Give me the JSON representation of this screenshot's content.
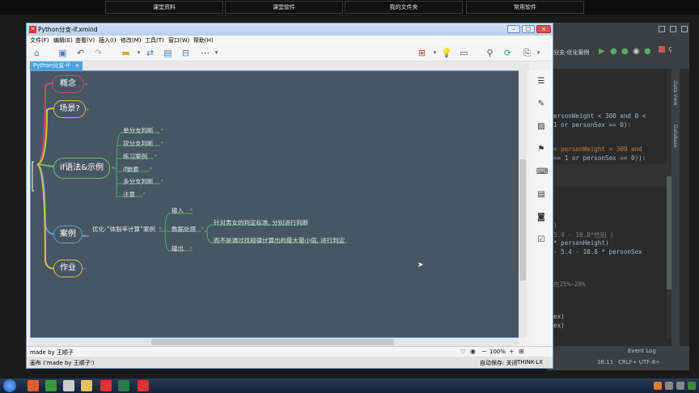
{
  "top_tabs": [
    "课堂资料",
    "课堂软件",
    "我的文件夹",
    "常用软件"
  ],
  "window": {
    "title": "Python分支-if.xmind",
    "menu": [
      "文件(F)",
      "编辑(E)",
      "查看(V)",
      "插入(I)",
      "修改(M)",
      "工具(T)",
      "窗口(W)",
      "帮助(H)"
    ],
    "tab": "Python分支-if",
    "tab_close": "×"
  },
  "mindmap": {
    "topics": {
      "concept": "概念",
      "scene": "场景?",
      "if_syntax": "if语法&示例",
      "case": "案例",
      "homework": "作业"
    },
    "if_children": [
      "单分支判断",
      "双分支判断",
      "练习案例",
      "if嵌套",
      "多分支判断",
      "注意"
    ],
    "case_child": "优化-“体脂率计算”案例",
    "case_grandchildren": [
      "输入",
      "数据处理",
      "输出"
    ],
    "processing_children": [
      "针对男女的判定标准, 分别进行判断",
      "而不是通过找规律计算出的最大最小值, 进行判定"
    ]
  },
  "bottom": {
    "author": "made by 王顺子",
    "zoom": "100%",
    "zoom_minus": "−",
    "zoom_plus": "+"
  },
  "status": {
    "left": "画布 ('made by 王顺子')",
    "autosave": "自动保存: 关闭",
    "machine": "THINK-LX"
  },
  "ide": {
    "tab": "分支-优化案例",
    "side_labels": [
      "Data View",
      "Database"
    ],
    "code_lines": [
      "ersonWeight < 300 and 0 <",
      "1 or personSex == 0):",
      "< personWeight < 300 and",
      "== 1 or personSex == 0)):",
      ")",
      "5.4 - 10.8*性别 (",
      "* personHeight)",
      "- 5.4 - 10.8 * personSex",
      "在25%~28%",
      "ex)",
      "ex)"
    ],
    "event_log": "Event Log",
    "status_pos": "38:11",
    "status_enc": "CRLF÷  UTF-8÷"
  }
}
